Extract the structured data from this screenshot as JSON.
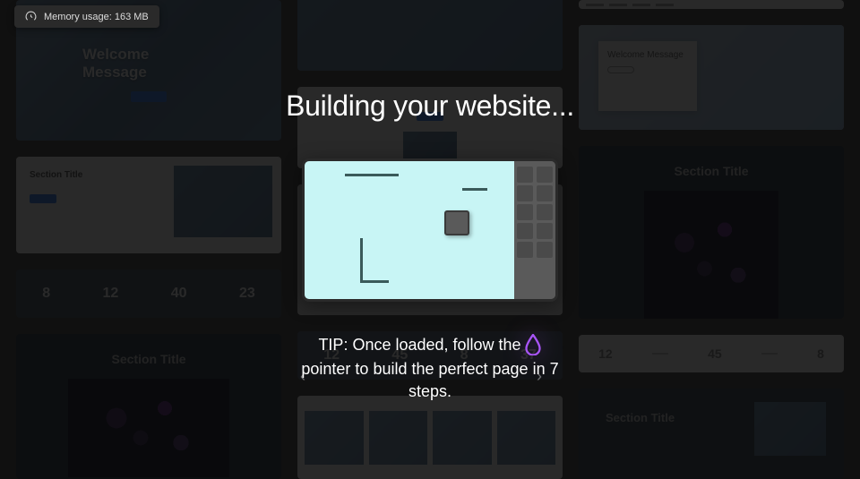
{
  "memory": {
    "label": "Memory usage: 163 MB"
  },
  "overlay": {
    "title": "Building your website...",
    "tip_before": "TIP: Once loaded, follow the",
    "tip_after": "pointer to build the perfect page in 7 steps."
  },
  "templates": {
    "welcome": "Welcome Message",
    "welcome_card_title": "Welcome Message",
    "section": "Section Title",
    "stats_a": [
      "8",
      "12",
      "40",
      "23"
    ],
    "stats_b": [
      "12",
      "45",
      "8",
      "37"
    ],
    "stats_c": [
      "12",
      "45",
      "8"
    ]
  }
}
